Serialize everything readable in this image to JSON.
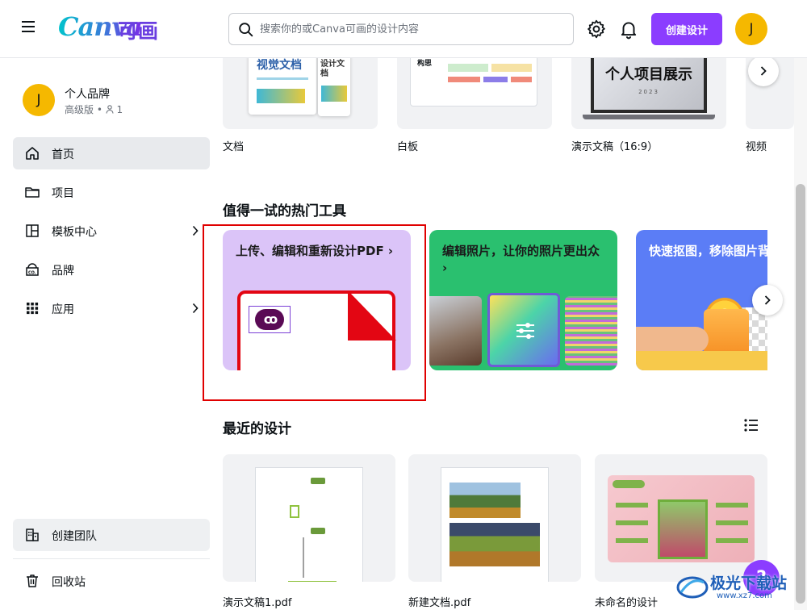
{
  "header": {
    "logo_text": "Canva",
    "logo_cn": "可画",
    "search_placeholder": "搜索你的或Canva可画的设计内容",
    "create_button": "创建设计",
    "avatar_initial": "J"
  },
  "sidebar": {
    "brand_name": "个人品牌",
    "brand_plan": "高级版 • ",
    "brand_members": "1",
    "avatar_initial": "J",
    "items": [
      {
        "label": "首页",
        "active": true
      },
      {
        "label": "项目"
      },
      {
        "label": "模板中心"
      },
      {
        "label": "品牌"
      },
      {
        "label": "应用"
      }
    ],
    "team_button": "创建团队",
    "trash_button": "回收站"
  },
  "templates": {
    "items": [
      {
        "label": "文档",
        "thumb_title": "视觉文档",
        "thumb_sub": "设计文档"
      },
      {
        "label": "白板",
        "thumb_title": "构思"
      },
      {
        "label": "演示文稿（16:9）",
        "thumb_title": "个人项目展示",
        "thumb_year": "2023"
      },
      {
        "label": "视频"
      }
    ]
  },
  "tools": {
    "title": "值得一试的热门工具",
    "items": [
      {
        "title": "上传、编辑和重新设计PDF ›",
        "color": "#dbc4f8"
      },
      {
        "title": "编辑照片，让你的照片更出众 ›",
        "color": "#2ac06f"
      },
      {
        "title": "快速抠图，移除图片背景",
        "color": "#5b7df6"
      }
    ]
  },
  "recent": {
    "title": "最近的设计",
    "items": [
      {
        "label": "演示文稿1.pdf"
      },
      {
        "label": "新建文档.pdf"
      },
      {
        "label": "未命名的设计"
      }
    ]
  },
  "help_label": "?",
  "watermark": {
    "text": "极光下载站",
    "sub": "www.xz7.com"
  },
  "colors": {
    "accent": "#8b3dff",
    "avatar": "#f5b800",
    "highlight": "#e00000"
  }
}
